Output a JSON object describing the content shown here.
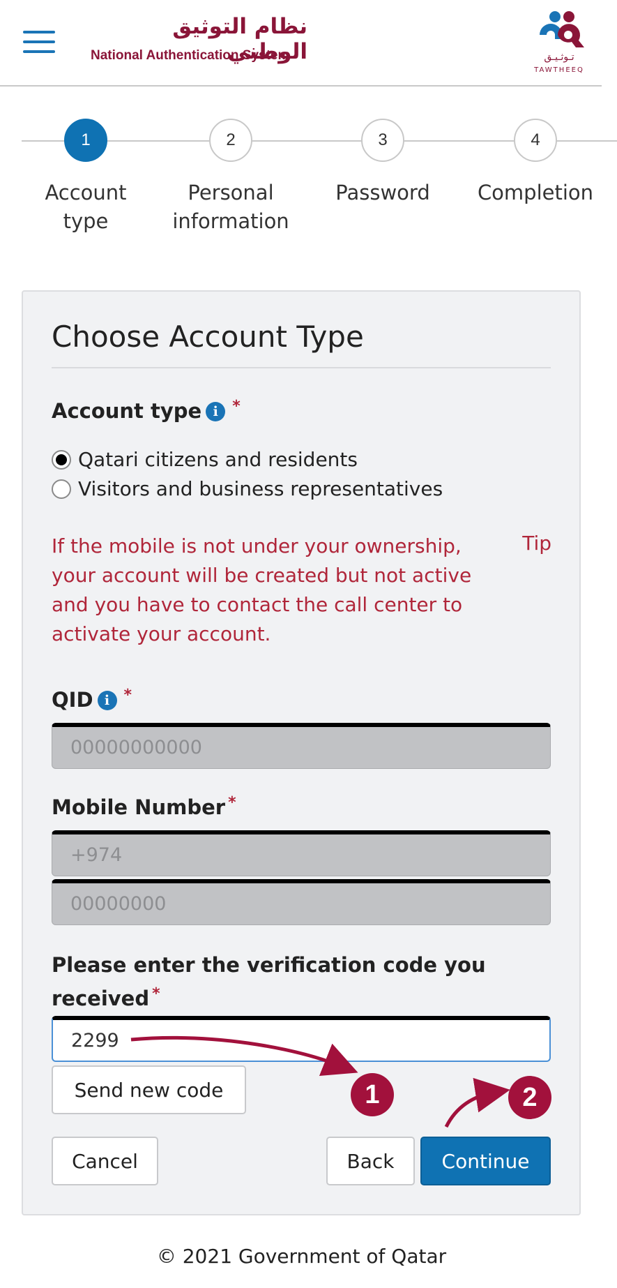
{
  "header": {
    "brand_ar": "نظام التوثيق الوطني",
    "brand_en": "National Authentication System",
    "logo_ar": "تـوثـيـق",
    "logo_en": "TAWTHEEQ"
  },
  "stepper": {
    "steps": [
      {
        "number": "1",
        "label_line1": "Account",
        "label_line2": "type",
        "active": true
      },
      {
        "number": "2",
        "label_line1": "Personal",
        "label_line2": "information",
        "active": false
      },
      {
        "number": "3",
        "label_line1": "Password",
        "label_line2": "",
        "active": false
      },
      {
        "number": "4",
        "label_line1": "Completion",
        "label_line2": "",
        "active": false
      }
    ]
  },
  "form": {
    "title": "Choose Account Type",
    "account_type_label": "Account type",
    "required_mark": "*",
    "options": [
      {
        "label": "Qatari citizens and residents",
        "checked": true
      },
      {
        "label": "Visitors and business representatives",
        "checked": false
      }
    ],
    "warning": "If the mobile is not under your ownership, your account will be created but not active and you have to contact the call center to activate your account.",
    "tip_label": "Tip",
    "qid_label": "QID",
    "qid_placeholder": "00000000000",
    "mobile_label": "Mobile Number",
    "mobile_prefix_placeholder": "+974",
    "mobile_placeholder": "00000000",
    "verification_label_line1": "Please enter the verification code you",
    "verification_label_line2": "received",
    "verification_value": "2299",
    "send_new_code": "Send new code",
    "cancel": "Cancel",
    "back": "Back",
    "continue": "Continue"
  },
  "annotations": {
    "badge1": "1",
    "badge2": "2",
    "color": "#a2113c"
  },
  "footer": {
    "text": "© 2021 Government of Qatar"
  },
  "colors": {
    "accent": "#0f72b3",
    "brand": "#8a1538",
    "warning": "#b0263a"
  }
}
